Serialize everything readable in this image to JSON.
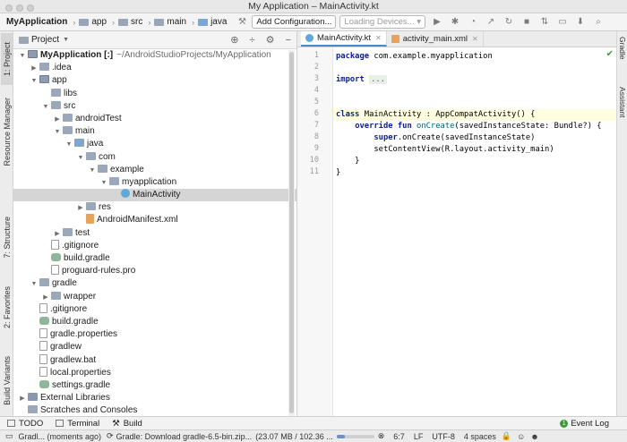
{
  "window": {
    "title": "My Application – MainActivity.kt"
  },
  "navbar": {
    "crumbs": [
      "MyApplication",
      "app",
      "src",
      "main",
      "java"
    ],
    "add_config": "Add Configuration...",
    "devices": "Loading Devices..."
  },
  "left_tabs": [
    "1: Project",
    "Resource Manager",
    "7: Structure",
    "2: Favorites",
    "Build Variants"
  ],
  "right_tabs": [
    "Gradle",
    "Assistant"
  ],
  "project_panel": {
    "title": "Project",
    "tree": [
      {
        "label": "MyApplication [:]",
        "extra": "~/AndroidStudioProjects/MyApplication",
        "level": 0,
        "arrow": "open",
        "icon": "modfold",
        "bold": true
      },
      {
        "label": ".idea",
        "level": 1,
        "arrow": "closed",
        "icon": "folder"
      },
      {
        "label": "app",
        "level": 1,
        "arrow": "open",
        "icon": "modfold"
      },
      {
        "label": "libs",
        "level": 2,
        "arrow": "",
        "icon": "folder"
      },
      {
        "label": "src",
        "level": 2,
        "arrow": "open",
        "icon": "folder"
      },
      {
        "label": "androidTest",
        "level": 3,
        "arrow": "closed",
        "icon": "folder"
      },
      {
        "label": "main",
        "level": 3,
        "arrow": "open",
        "icon": "folder"
      },
      {
        "label": "java",
        "level": 4,
        "arrow": "open",
        "icon": "src"
      },
      {
        "label": "com",
        "level": 5,
        "arrow": "open",
        "icon": "folder"
      },
      {
        "label": "example",
        "level": 6,
        "arrow": "open",
        "icon": "folder"
      },
      {
        "label": "myapplication",
        "level": 7,
        "arrow": "open",
        "icon": "folder"
      },
      {
        "label": "MainActivity",
        "level": 8,
        "arrow": "",
        "icon": "kt",
        "selected": true
      },
      {
        "label": "res",
        "level": 5,
        "arrow": "closed",
        "icon": "folder"
      },
      {
        "label": "AndroidManifest.xml",
        "level": 5,
        "arrow": "",
        "icon": "xml"
      },
      {
        "label": "test",
        "level": 3,
        "arrow": "closed",
        "icon": "folder"
      },
      {
        "label": ".gitignore",
        "level": 2,
        "arrow": "",
        "icon": "file"
      },
      {
        "label": "build.gradle",
        "level": 2,
        "arrow": "",
        "icon": "gradle"
      },
      {
        "label": "proguard-rules.pro",
        "level": 2,
        "arrow": "",
        "icon": "file"
      },
      {
        "label": "gradle",
        "level": 1,
        "arrow": "open",
        "icon": "folder"
      },
      {
        "label": "wrapper",
        "level": 2,
        "arrow": "closed",
        "icon": "folder"
      },
      {
        "label": ".gitignore",
        "level": 1,
        "arrow": "",
        "icon": "file"
      },
      {
        "label": "build.gradle",
        "level": 1,
        "arrow": "",
        "icon": "gradle"
      },
      {
        "label": "gradle.properties",
        "level": 1,
        "arrow": "",
        "icon": "file"
      },
      {
        "label": "gradlew",
        "level": 1,
        "arrow": "",
        "icon": "file"
      },
      {
        "label": "gradlew.bat",
        "level": 1,
        "arrow": "",
        "icon": "file"
      },
      {
        "label": "local.properties",
        "level": 1,
        "arrow": "",
        "icon": "file"
      },
      {
        "label": "settings.gradle",
        "level": 1,
        "arrow": "",
        "icon": "gradle"
      },
      {
        "label": "External Libraries",
        "level": 0,
        "arrow": "closed",
        "icon": "lib"
      },
      {
        "label": "Scratches and Consoles",
        "level": 0,
        "arrow": "",
        "icon": "folder"
      }
    ]
  },
  "editor": {
    "tabs": [
      {
        "label": "MainActivity.kt",
        "icon": "kt",
        "active": true
      },
      {
        "label": "activity_main.xml",
        "icon": "xml",
        "active": false
      }
    ],
    "line_numbers": [
      "1",
      "2",
      "3",
      "4",
      "5",
      "6",
      "7",
      "8",
      "9",
      "10",
      "11"
    ],
    "lines": [
      {
        "parts": [
          {
            "t": "package",
            "c": "kw"
          },
          {
            "t": " com.example.myapplication"
          }
        ]
      },
      {
        "parts": []
      },
      {
        "parts": [
          {
            "t": "import",
            "c": "kw"
          },
          {
            "t": " "
          },
          {
            "t": "...",
            "c": "fold-imp"
          }
        ]
      },
      {
        "parts": []
      },
      {
        "parts": [
          {
            "t": "class",
            "c": "kw"
          },
          {
            "t": " MainActivity : AppCompatActivity() {"
          }
        ],
        "highlight": true
      },
      {
        "parts": [
          {
            "t": "    "
          },
          {
            "t": "override fun",
            "c": "kw"
          },
          {
            "t": " "
          },
          {
            "t": "onCreate",
            "c": "fn"
          },
          {
            "t": "(savedInstanceState: Bundle?) {"
          }
        ]
      },
      {
        "parts": [
          {
            "t": "        "
          },
          {
            "t": "super",
            "c": "kw"
          },
          {
            "t": ".onCreate(savedInstanceState)"
          }
        ]
      },
      {
        "parts": [
          {
            "t": "        setContentView(R.layout."
          },
          {
            "t": "activity_main"
          },
          {
            "t": ")"
          }
        ]
      },
      {
        "parts": [
          {
            "t": "    }"
          }
        ]
      },
      {
        "parts": [
          {
            "t": "}"
          }
        ]
      }
    ]
  },
  "bottom_tabs": {
    "todo": "TODO",
    "terminal": "Terminal",
    "build": "Build",
    "event_log": "Event Log"
  },
  "status": {
    "left": "Gradl... (moments ago)",
    "task": "Gradle: Download gradle-6.5-bin.zip...",
    "size": "(23.07 MB / 102.36 ...",
    "progress": 0.22,
    "pos": "6:7",
    "lf": "LF",
    "enc": "UTF-8",
    "indent": "4 spaces"
  }
}
